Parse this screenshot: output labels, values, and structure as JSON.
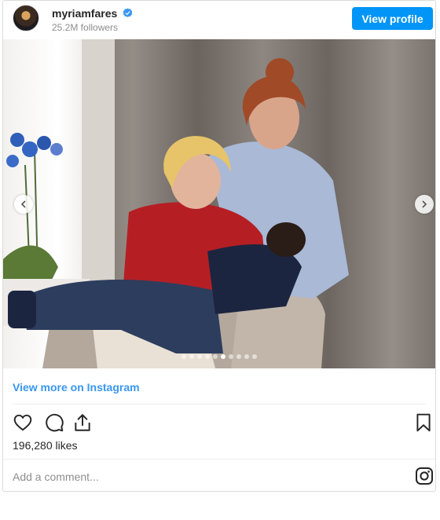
{
  "header": {
    "username": "myriamfares",
    "followers": "25.2M followers",
    "view_profile_label": "View profile",
    "verified_icon": "verified-badge-icon",
    "verified_color": "#3897f0"
  },
  "carousel": {
    "slide_count": 10,
    "active_index": 5,
    "prev_icon": "chevron-left-icon",
    "next_icon": "chevron-right-icon"
  },
  "view_more_label": "View more on Instagram",
  "actions": {
    "icons": [
      "heart-icon",
      "comment-icon",
      "share-icon",
      "bookmark-icon"
    ]
  },
  "likes": "196,280 likes",
  "comment": {
    "placeholder": "Add a comment..."
  },
  "colors": {
    "accent": "#0095f6",
    "link": "#3897f0",
    "secondary_text": "#8e8e8e",
    "border": "#dbdbdb"
  }
}
